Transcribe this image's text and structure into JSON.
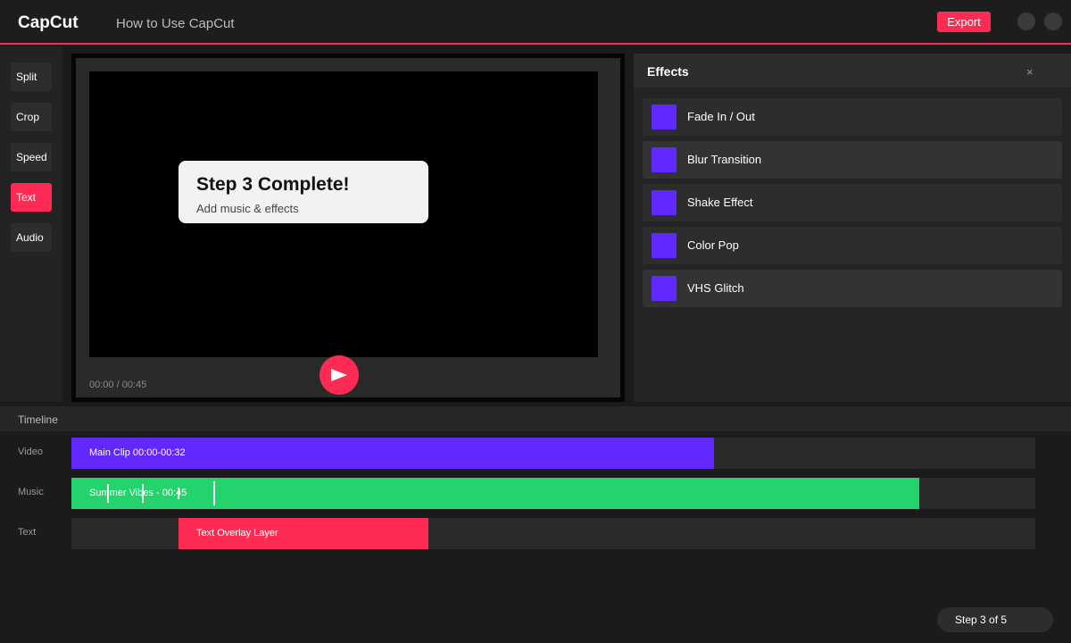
{
  "app": {
    "logo": "CapCut",
    "title": "How to Use CapCut",
    "export_label": "Export"
  },
  "tools": [
    {
      "label": "Split",
      "active": false
    },
    {
      "label": "Crop",
      "active": false
    },
    {
      "label": "Speed",
      "active": false
    },
    {
      "label": "Text",
      "active": true
    },
    {
      "label": "Audio",
      "active": false
    }
  ],
  "preview": {
    "step_title": "Step 3 Complete!",
    "step_subtitle": "Add music & effects",
    "timecode": "00:00 / 00:45"
  },
  "effects": {
    "title": "Effects",
    "close_label": "×",
    "items": [
      {
        "label": "Fade In / Out",
        "icon": "effect-swatch",
        "color": "#6129ff"
      },
      {
        "label": "Blur Transition",
        "icon": "effect-swatch",
        "color": "#6129ff"
      },
      {
        "label": "Shake Effect",
        "icon": "effect-swatch",
        "color": "#6129ff"
      },
      {
        "label": "Color Pop",
        "icon": "effect-swatch",
        "color": "#6129ff"
      },
      {
        "label": "VHS Glitch",
        "icon": "effect-swatch",
        "color": "#6129ff"
      }
    ]
  },
  "timeline": {
    "title": "Timeline",
    "tracks": [
      {
        "label": "Video",
        "clip": "Main Clip 00:00-00:32",
        "color": "#6129ff"
      },
      {
        "label": "Music",
        "clip": "Summer Vibes - 00:45",
        "color": "#24d36b"
      },
      {
        "label": "Text",
        "clip": "Text Overlay Layer",
        "color": "#fe2c55"
      }
    ]
  },
  "step_indicator": "Step 3 of 5",
  "colors": {
    "accent": "#fe2c55",
    "purple": "#6129ff",
    "green": "#24d36b"
  }
}
